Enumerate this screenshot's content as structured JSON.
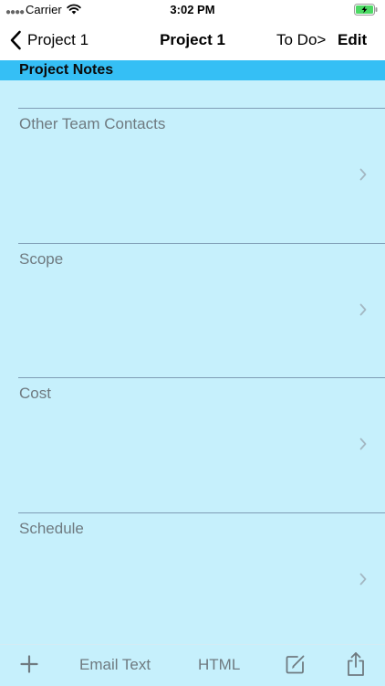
{
  "status_bar": {
    "signal_icon": "signal-dots-icon",
    "carrier": "Carrier",
    "wifi_icon": "wifi-icon",
    "time": "3:02 PM",
    "battery_icon": "battery-charging-icon",
    "battery_color": "#4cd964"
  },
  "nav": {
    "back_icon": "chevron-left-icon",
    "back_label": "Project 1",
    "title": "Project 1",
    "todo_label": "To Do>",
    "edit_label": "Edit"
  },
  "section": {
    "title": "Project Notes",
    "color": "#35bff5"
  },
  "rows": [
    {
      "label": "Other Team Contacts"
    },
    {
      "label": "Scope"
    },
    {
      "label": "Cost"
    },
    {
      "label": "Schedule"
    }
  ],
  "toolbar": {
    "add_icon": "plus-icon",
    "email_label": "Email Text",
    "html_label": "HTML",
    "compose_icon": "compose-icon",
    "share_icon": "share-icon"
  },
  "colors": {
    "background": "#c6f0fc",
    "muted_text": "#6f7a80",
    "separator": "#7f9db5"
  }
}
